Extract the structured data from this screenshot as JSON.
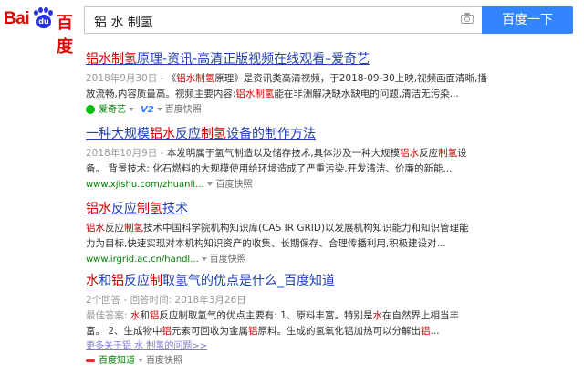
{
  "header": {
    "logo_bai": "Bai",
    "logo_du": "du",
    "logo_text": "百度",
    "query": "铝 水 制氢",
    "search_button": "百度一下"
  },
  "results": [
    {
      "title_parts": [
        [
          "em",
          "铝水制氢"
        ],
        [
          "t",
          "原理-资讯-高清正版视频在线观看–爱奇艺"
        ]
      ],
      "snippet_parts": [
        [
          "date",
          "2018年9月30日 - "
        ],
        [
          "t",
          "《"
        ],
        [
          "em",
          "铝水制氢"
        ],
        [
          "t",
          "原理》是资讯类高清视频，于2018-09-30上映,视频画面清晰,播放流畅,内容质量高。视频主要内容:"
        ],
        [
          "em",
          "铝水制氢"
        ],
        [
          "t",
          "能在非洲解决缺水缺电的问题,清洁无污染..."
        ]
      ],
      "source": "爱奇艺",
      "badge": "V2",
      "snapshot": "百度快照"
    },
    {
      "title_parts": [
        [
          "t",
          "一种大规模"
        ],
        [
          "em",
          "铝水"
        ],
        [
          "t",
          "反应"
        ],
        [
          "em",
          "制氢"
        ],
        [
          "t",
          "设备的制作方法"
        ]
      ],
      "snippet_parts": [
        [
          "date",
          "2018年10月9日 - "
        ],
        [
          "t",
          "本发明属于氢气制造以及储存技术,具体涉及一种大规模"
        ],
        [
          "em",
          "铝水"
        ],
        [
          "t",
          "反应"
        ],
        [
          "em",
          "制氢"
        ],
        [
          "t",
          "设备。 背景技术: 化石燃料的大规模使用给环境造成了严重污染,开发清洁、价廉的新能..."
        ]
      ],
      "source": "www.xjishu.com/zhuanli...",
      "snapshot": "百度快照"
    },
    {
      "title_parts": [
        [
          "em",
          "铝水"
        ],
        [
          "t",
          "反应"
        ],
        [
          "em",
          "制氢"
        ],
        [
          "t",
          "技术"
        ]
      ],
      "snippet_parts": [
        [
          "em",
          "铝水"
        ],
        [
          "t",
          "反应"
        ],
        [
          "em",
          "制氢"
        ],
        [
          "t",
          "技术中国科学院机构知识库(CAS IR GRID)以发展机构知识能力和知识管理能力为目标,快速实现对本机构知识资产的收集、长期保存、合理传播利用,积极建设对..."
        ]
      ],
      "source": "www.irgrid.ac.cn/handl...",
      "snapshot": "百度快照"
    },
    {
      "title_parts": [
        [
          "em",
          "水"
        ],
        [
          "t",
          "和"
        ],
        [
          "em",
          "铝"
        ],
        [
          "t",
          "反应"
        ],
        [
          "em",
          "制"
        ],
        [
          "t",
          "取氢气的优点是什么_百度知道"
        ]
      ],
      "snippet_parts": [
        [
          "date",
          "2个回答 - 回答时间: 2018年3月26日"
        ],
        [
          "br",
          ""
        ],
        [
          "date",
          "最佳答案: "
        ],
        [
          "em",
          "水"
        ],
        [
          "t",
          "和"
        ],
        [
          "em",
          "铝"
        ],
        [
          "t",
          "反应制取氢气的优点主要有: 1、原料丰富。特别是"
        ],
        [
          "em",
          "水"
        ],
        [
          "t",
          "在自然界上相当丰富。 2、生成物中"
        ],
        [
          "em",
          "铝"
        ],
        [
          "t",
          "元素可回收为金属"
        ],
        [
          "em",
          "铝"
        ],
        [
          "t",
          "原料。生成的氢氧化铝加热可以分解出"
        ],
        [
          "em",
          "铝"
        ],
        [
          "t",
          "..."
        ]
      ],
      "more": "更多关于铝 水 制氢的问题>>",
      "source": "百度知道",
      "snapshot": "百度快照"
    }
  ]
}
